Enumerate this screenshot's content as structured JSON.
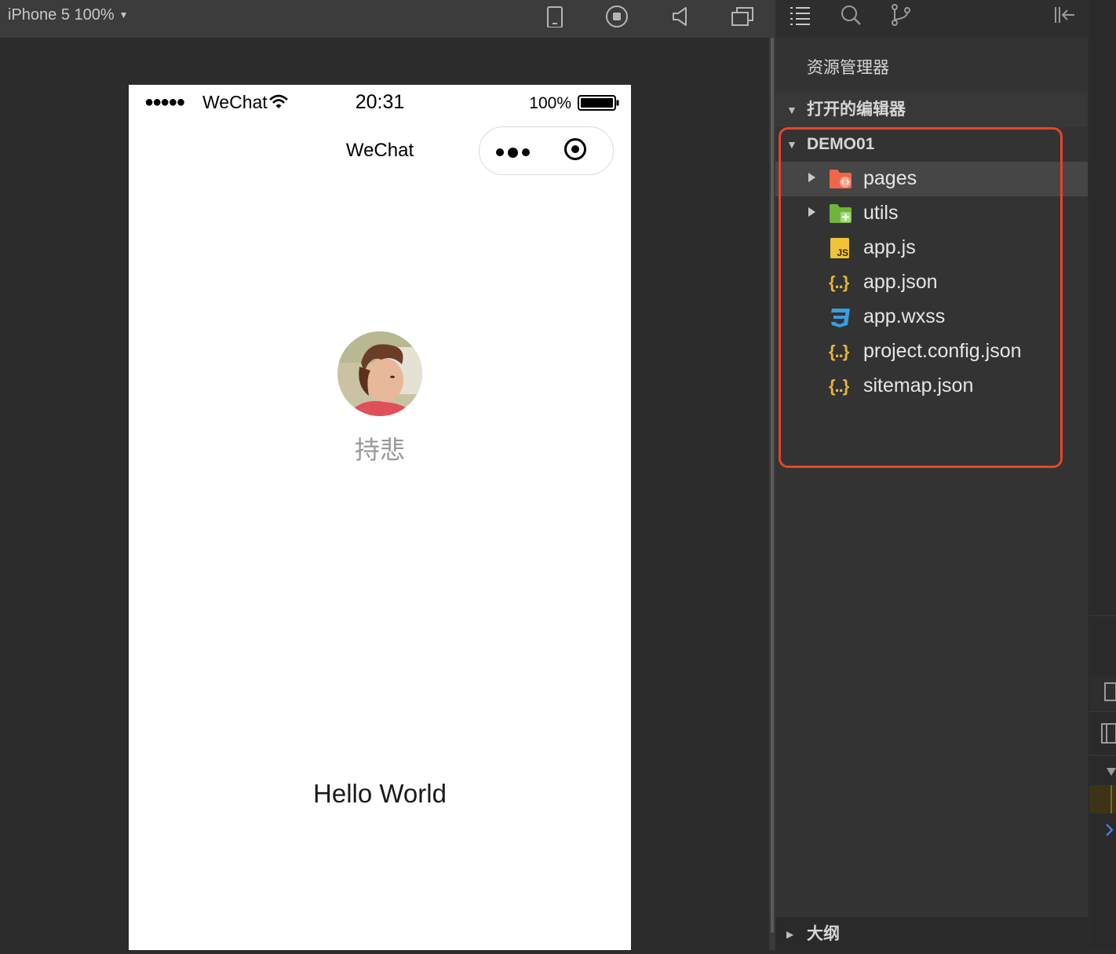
{
  "simulator": {
    "device_label": "iPhone 5 100%",
    "status_bar": {
      "signal": "●●●●●",
      "carrier": "WeChat",
      "time": "20:31",
      "battery": "100%"
    },
    "nav_title": "WeChat",
    "user": {
      "nickname": "持悲"
    },
    "content": "Hello World"
  },
  "explorer": {
    "title": "资源管理器",
    "open_editors_label": "打开的编辑器",
    "project_name": "DEMO01",
    "files": [
      {
        "name": "pages",
        "icon": "folder-pages-icon"
      },
      {
        "name": "utils",
        "icon": "folder-utils-icon"
      },
      {
        "name": "app.js",
        "icon": "js-file-icon"
      },
      {
        "name": "app.json",
        "icon": "json-file-icon"
      },
      {
        "name": "app.wxss",
        "icon": "css-file-icon"
      },
      {
        "name": "project.config.json",
        "icon": "json-file-icon"
      },
      {
        "name": "sitemap.json",
        "icon": "json-file-icon"
      }
    ],
    "json_glyph": "{..}",
    "js_badge": "JS",
    "outline_label": "大纲"
  },
  "colors": {
    "highlight": "#e8442a",
    "folder_pages": "#f0664a",
    "folder_utils": "#6fb43c",
    "json": "#e8b43c",
    "js": "#f0c23a",
    "css": "#3a9de0"
  }
}
